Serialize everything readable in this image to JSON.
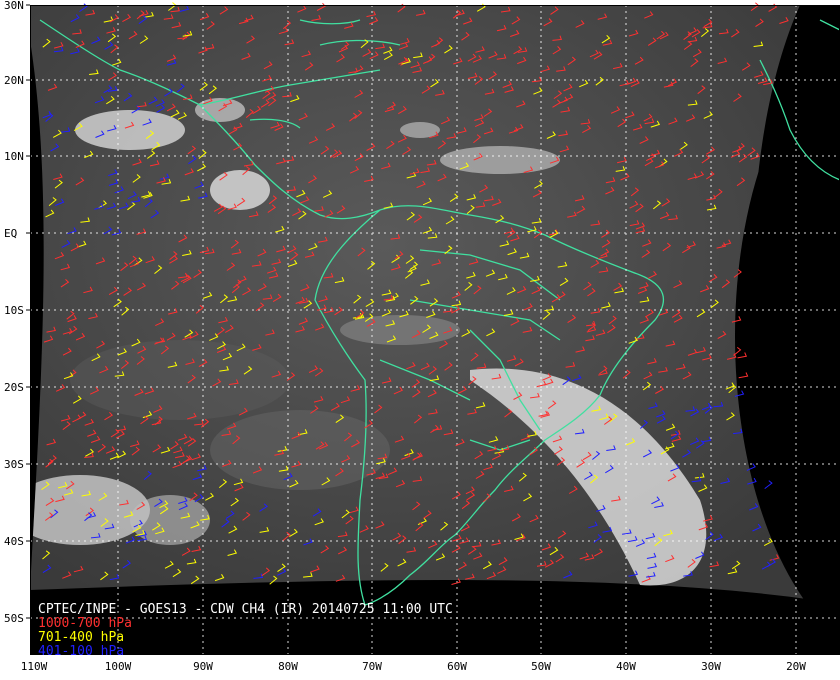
{
  "caption": {
    "title": "CPTEC/INPE - GOES13 - CDW CH4 (IR) 20140725 11:00 UTC",
    "legend": [
      {
        "label": "1000-700 hPa",
        "color": "#ff3030"
      },
      {
        "label": "701-400 hPa",
        "color": "#ffff00"
      },
      {
        "label": "401-100 hPa",
        "color": "#2020ff"
      }
    ],
    "title_color": "#ffffff"
  },
  "axes": {
    "lat_labels": [
      "30N",
      "20N",
      "10N",
      "EQ",
      "10S",
      "20S",
      "30S",
      "40S",
      "50S"
    ],
    "lon_labels": [
      "110W",
      "100W",
      "90W",
      "80W",
      "70W",
      "60W",
      "50W",
      "40W",
      "30W",
      "20W"
    ]
  },
  "colors": {
    "coastline": "#40e0a0",
    "grid": "#ffffff",
    "space": "#000000",
    "earth_base": "#4a4a4a"
  }
}
